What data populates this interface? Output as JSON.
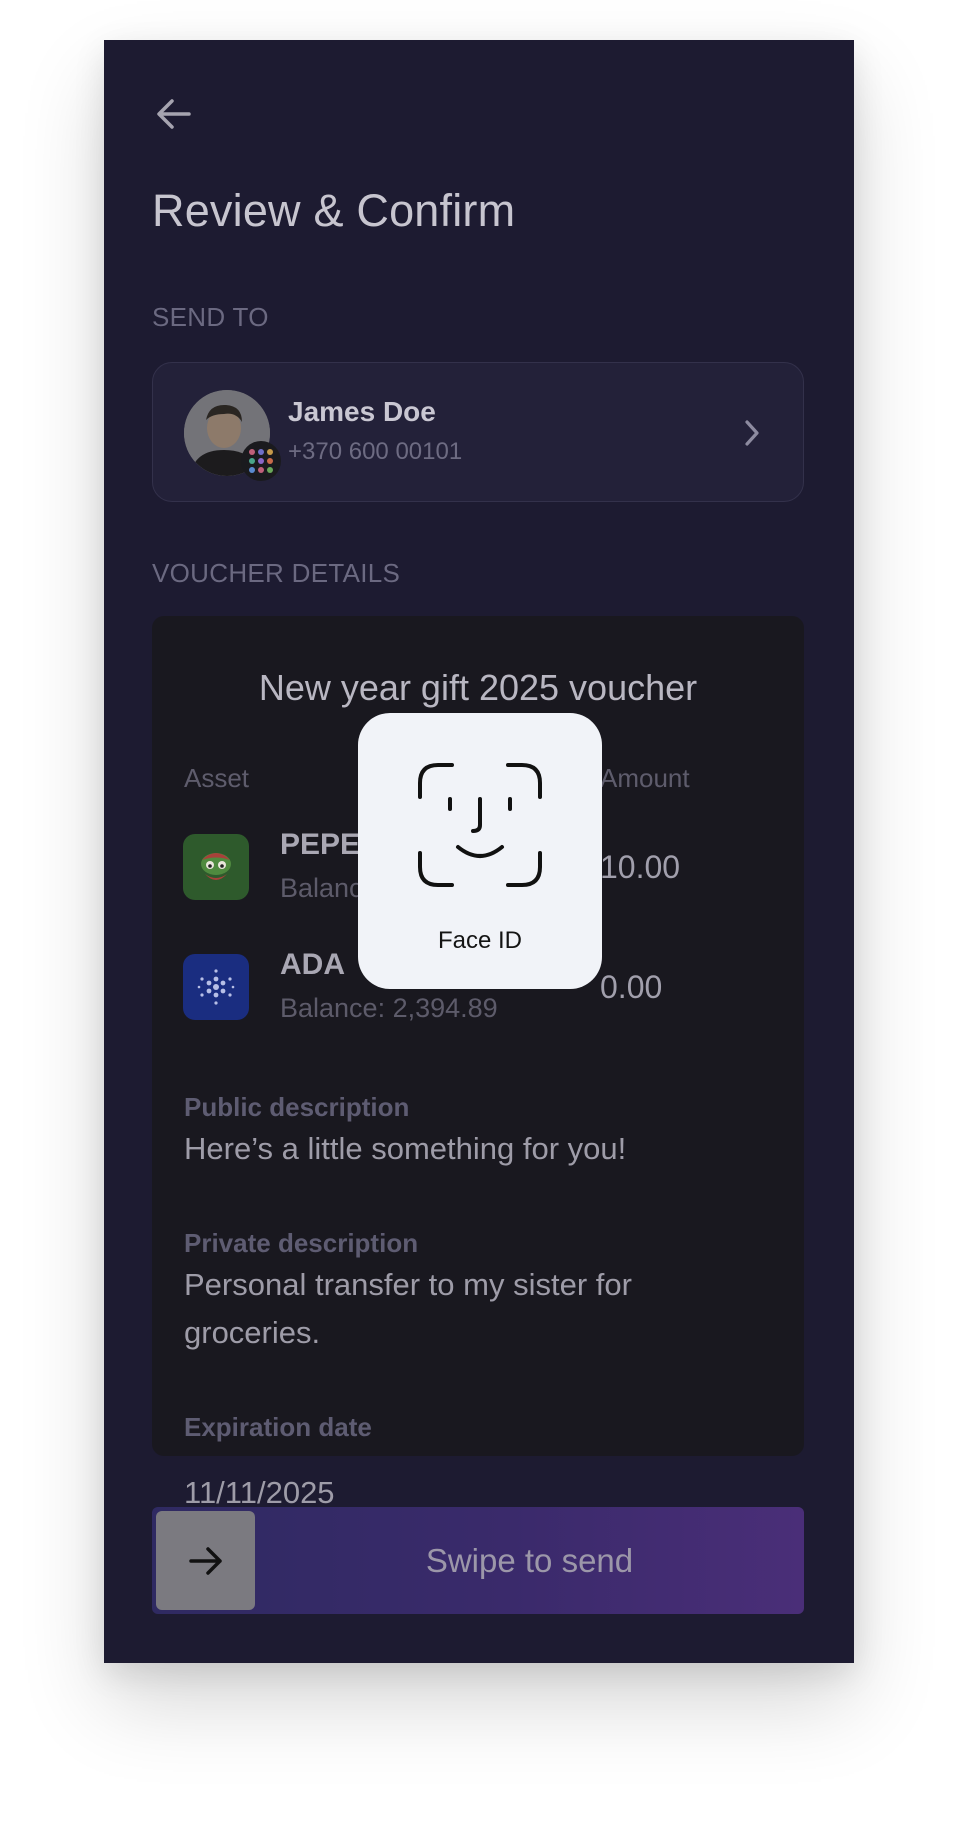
{
  "header": {
    "title": "Review & Confirm"
  },
  "send_to": {
    "section_label": "SEND TO",
    "recipient_name": "James Doe",
    "recipient_phone": "+370 600 00101"
  },
  "voucher": {
    "section_label": "VOUCHER DETAILS",
    "title": "New year gift 2025 voucher",
    "asset_column": "Asset",
    "amount_column": "Amount",
    "assets": [
      {
        "symbol": "PEPE",
        "balance": "Balanc",
        "amount": "10.00",
        "icon": "pepe-frog-icon",
        "icon_bg": "#2e5a2c"
      },
      {
        "symbol": "ADA",
        "balance": "Balance: 2,394.89",
        "amount": "0.00",
        "icon": "cardano-icon",
        "icon_bg": "#1a2d80"
      }
    ],
    "public_description_label": "Public description",
    "public_description": "Here’s a little something for you!",
    "private_description_label": "Private description",
    "private_description": "Personal transfer to my sister for groceries.",
    "expiration_label": "Expiration date",
    "expiration": "11/11/2025"
  },
  "swipe": {
    "label": "Swipe to send"
  },
  "face_id": {
    "label": "Face ID"
  },
  "colors": {
    "background": "#1d1b31",
    "swipe_gradient_start": "#2f2a62",
    "swipe_gradient_end": "#4a2e78",
    "face_id_card": "#f1f3f8"
  }
}
